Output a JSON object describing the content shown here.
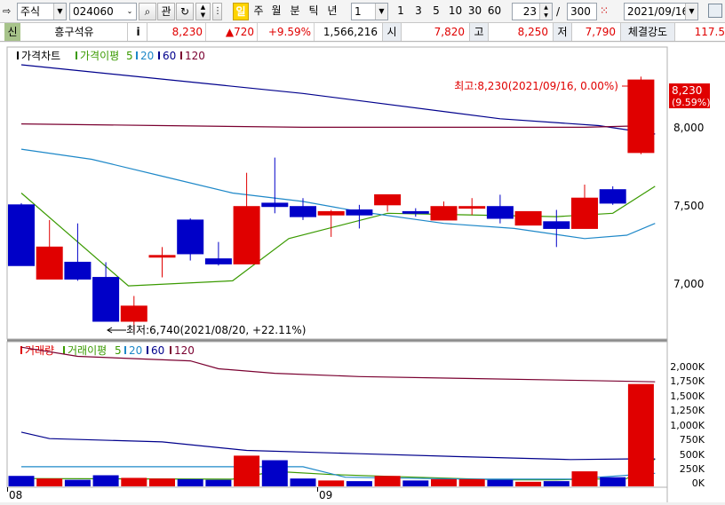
{
  "toolbar": {
    "market_type": "주식",
    "stock_code": "024060",
    "btn_gwan": "관",
    "period_buttons": [
      "일",
      "주",
      "월",
      "분",
      "틱",
      "년"
    ],
    "unit_value": "1",
    "quick_units": [
      "1",
      "3",
      "5",
      "10",
      "30",
      "60"
    ],
    "count_value": "23",
    "count_separator": "/",
    "count_total": "300",
    "date_value": "2021/09/16"
  },
  "quote": {
    "tag": "신",
    "name": "흥구석유",
    "info_button": "i",
    "price": "8,230",
    "change": "▲720",
    "change_rate": "+9.59%",
    "volume": "1,566,216",
    "open_label": "시",
    "open": "7,820",
    "high_label": "고",
    "high": "8,250",
    "low_label": "저",
    "low": "7,790",
    "strength_label": "체결강도",
    "strength": "117.5"
  },
  "colors": {
    "up": "#e00000",
    "down": "#0000c8",
    "ma5": "#3a9a00",
    "ma20": "#1e88c8",
    "ma60": "#00008c",
    "ma120": "#7a0030"
  },
  "price_panel": {
    "legend": {
      "title": "가격차트",
      "ma_name": "가격이평",
      "p5": "5",
      "p20": "20",
      "p60": "60",
      "p120": "120"
    },
    "max_annotation": "최고:8,230(2021/09/16, 0.00%)",
    "min_annotation": "최저:6,740(2021/08/20, +22.11%)",
    "current_price_tag": "8,230",
    "current_rate_tag": "(9.59%)",
    "y_ticks": [
      "8,000",
      "7,500",
      "7,000"
    ]
  },
  "volume_panel": {
    "legend": {
      "title": "거래량",
      "ma_name": "거래이평",
      "p5": "5",
      "p20": "20",
      "p60": "60",
      "p120": "120"
    },
    "y_ticks": [
      "2,000K",
      "1,750K",
      "1,500K",
      "1,250K",
      "1,000K",
      "750K",
      "500K",
      "250K",
      "0K"
    ]
  },
  "x_labels": [
    "08",
    "09"
  ],
  "chart_data": {
    "type": "candlestick",
    "x_axis_labels": [
      "08",
      "09"
    ],
    "price_ylim": [
      6700,
      8420
    ],
    "volume_ylim": [
      0,
      2200000
    ],
    "candles": [
      {
        "o": 7490,
        "h": 7500,
        "l": 7130,
        "c": 7130
      },
      {
        "o": 7050,
        "h": 7400,
        "l": 7050,
        "c": 7240
      },
      {
        "o": 7150,
        "h": 7380,
        "l": 7040,
        "c": 7050
      },
      {
        "o": 7060,
        "h": 7150,
        "l": 6800,
        "c": 6800
      },
      {
        "o": 6800,
        "h": 6950,
        "l": 6740,
        "c": 6890
      },
      {
        "o": 7180,
        "h": 7240,
        "l": 7060,
        "c": 7190
      },
      {
        "o": 7400,
        "h": 7410,
        "l": 7160,
        "c": 7200
      },
      {
        "o": 7170,
        "h": 7270,
        "l": 7130,
        "c": 7140
      },
      {
        "o": 7140,
        "h": 7680,
        "l": 7140,
        "c": 7480
      },
      {
        "o": 7500,
        "h": 7770,
        "l": 7440,
        "c": 7480
      },
      {
        "o": 7480,
        "h": 7530,
        "l": 7400,
        "c": 7420
      },
      {
        "o": 7430,
        "h": 7460,
        "l": 7300,
        "c": 7450
      },
      {
        "o": 7460,
        "h": 7490,
        "l": 7350,
        "c": 7430
      },
      {
        "o": 7490,
        "h": 7550,
        "l": 7450,
        "c": 7550
      },
      {
        "o": 7450,
        "h": 7470,
        "l": 7420,
        "c": 7440
      },
      {
        "o": 7400,
        "h": 7510,
        "l": 7400,
        "c": 7480
      },
      {
        "o": 7470,
        "h": 7530,
        "l": 7430,
        "c": 7480
      },
      {
        "o": 7480,
        "h": 7550,
        "l": 7380,
        "c": 7410
      },
      {
        "o": 7370,
        "h": 7450,
        "l": 7370,
        "c": 7450
      },
      {
        "o": 7390,
        "h": 7460,
        "l": 7240,
        "c": 7350
      },
      {
        "o": 7350,
        "h": 7610,
        "l": 7350,
        "c": 7530
      },
      {
        "o": 7580,
        "h": 7600,
        "l": 7490,
        "c": 7500
      },
      {
        "o": 7800,
        "h": 8250,
        "l": 7790,
        "c": 8230
      }
    ],
    "volumes": [
      160000,
      120000,
      100000,
      170000,
      130000,
      120000,
      110000,
      100000,
      470000,
      400000,
      120000,
      90000,
      80000,
      160000,
      90000,
      110000,
      110000,
      100000,
      70000,
      80000,
      230000,
      140000,
      1566216
    ],
    "price_ma": {
      "ma5": [
        [
          0,
          7560
        ],
        [
          3.8,
          7010
        ],
        [
          7.5,
          7040
        ],
        [
          9.5,
          7290
        ],
        [
          13,
          7440
        ],
        [
          19,
          7420
        ],
        [
          21,
          7440
        ],
        [
          22.5,
          7600
        ]
      ],
      "ma20": [
        [
          0,
          7820
        ],
        [
          2.5,
          7760
        ],
        [
          5,
          7660
        ],
        [
          7.5,
          7560
        ],
        [
          10,
          7510
        ],
        [
          12,
          7450
        ],
        [
          15,
          7380
        ],
        [
          17.5,
          7350
        ],
        [
          20,
          7290
        ],
        [
          21.5,
          7310
        ],
        [
          22.5,
          7380
        ]
      ],
      "ma60": [
        [
          0,
          8320
        ],
        [
          10,
          8150
        ],
        [
          17,
          8000
        ],
        [
          20.5,
          7960
        ],
        [
          22.5,
          7910
        ]
      ],
      "ma120": [
        [
          0,
          7970
        ],
        [
          5,
          7960
        ],
        [
          10,
          7950
        ],
        [
          15,
          7950
        ],
        [
          20,
          7950
        ],
        [
          22.3,
          7960
        ]
      ]
    },
    "volume_ma": {
      "ma5": [
        [
          0,
          120000
        ],
        [
          7.5,
          110000
        ],
        [
          9,
          230000
        ],
        [
          11,
          180000
        ],
        [
          14,
          140000
        ],
        [
          17,
          100000
        ],
        [
          19,
          100000
        ],
        [
          21.5,
          120000
        ],
        [
          22.5,
          420000
        ]
      ],
      "ma20": [
        [
          0,
          300000
        ],
        [
          8,
          300000
        ],
        [
          10,
          300000
        ],
        [
          11.5,
          140000
        ],
        [
          16,
          110000
        ],
        [
          19.5,
          110000
        ],
        [
          22.5,
          200000
        ]
      ],
      "ma60": [
        [
          0,
          830000
        ],
        [
          1,
          730000
        ],
        [
          5,
          680000
        ],
        [
          8,
          550000
        ],
        [
          12,
          500000
        ],
        [
          16,
          450000
        ],
        [
          19.5,
          410000
        ],
        [
          21.5,
          420000
        ],
        [
          22.5,
          420000
        ]
      ],
      "ma120": [
        [
          0,
          2130000
        ],
        [
          2,
          1990000
        ],
        [
          6,
          1920000
        ],
        [
          7,
          1800000
        ],
        [
          9,
          1730000
        ],
        [
          12,
          1680000
        ],
        [
          16,
          1650000
        ],
        [
          20,
          1620000
        ],
        [
          22.5,
          1600000
        ]
      ]
    }
  }
}
